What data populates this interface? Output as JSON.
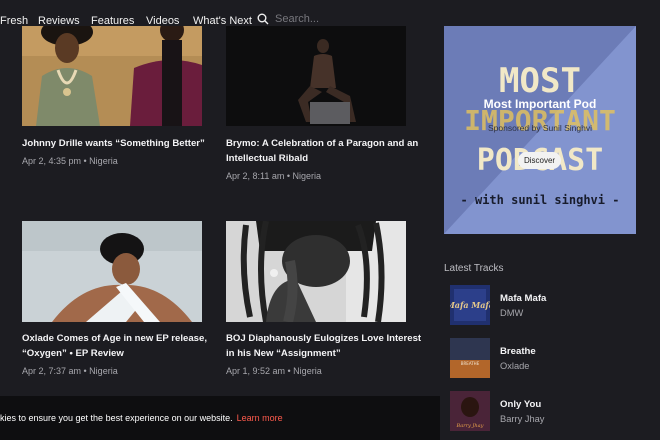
{
  "nav": {
    "items": [
      "Fresh",
      "Reviews",
      "Features",
      "Videos",
      "What's Next"
    ],
    "search_placeholder": "Search..."
  },
  "articles": [
    {
      "title_line1": "Johnny Drille wants “Something Better”",
      "title_line2": "",
      "meta": "Apr 2, 4:35 pm • Nigeria"
    },
    {
      "title_line1": "Brymo: A Celebration of a Paragon and an",
      "title_line2": "Intellectual Ribald",
      "meta": "Apr 2, 8:11 am • Nigeria"
    },
    {
      "title_line1": "Oxlade Comes of Age in new EP release,",
      "title_line2": "“Oxygen” • EP Review",
      "meta": "Apr 2, 7:37 am • Nigeria"
    },
    {
      "title_line1": "BOJ Diaphanously Eulogizes Love Interest",
      "title_line2": "in his New “Assignment”",
      "meta": "Apr 1, 9:52 am • Nigeria"
    }
  ],
  "promo": {
    "art_line1": "MOST",
    "art_line2": "IMPORTANT",
    "art_line3": "PODCAST",
    "art_line4": "- with sunil singhvi -",
    "title": "Most Important Pod",
    "subtitle": "Sponsored by Sunil Singhvi",
    "button": "Discover"
  },
  "latest_tracks": {
    "heading": "Latest Tracks",
    "items": [
      {
        "name": "Mafa Mafa",
        "artist": "DMW",
        "thumb_text": "Mafa Mafa"
      },
      {
        "name": "Breathe",
        "artist": "Oxlade",
        "thumb_text": "BREATHE"
      },
      {
        "name": "Only You",
        "artist": "Barry Jhay",
        "thumb_text": "Barry Jhay"
      }
    ]
  },
  "cookie": {
    "text": "kies to ensure you get the best experience on our website.",
    "link": "Learn more"
  },
  "colors": {
    "background": "#1c1c21",
    "link_accent": "#ff5b4d",
    "promo_bg": "#7a8bc5"
  }
}
